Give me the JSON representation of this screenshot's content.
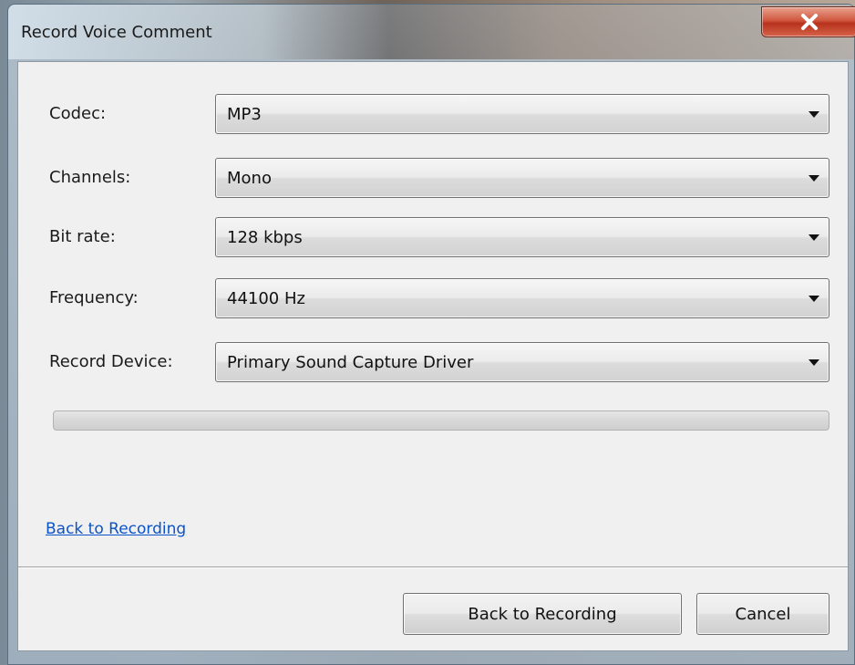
{
  "window": {
    "title": "Record Voice Comment",
    "close_icon": "close-icon"
  },
  "fields": [
    {
      "label": "Codec:",
      "value": "MP3"
    },
    {
      "label": "Channels:",
      "value": "Mono"
    },
    {
      "label": "Bit rate:",
      "value": "128 kbps"
    },
    {
      "label": "Frequency:",
      "value": "44100 Hz"
    },
    {
      "label": "Record Device:",
      "value": "Primary Sound Capture Driver"
    }
  ],
  "progress": {
    "percent": 0
  },
  "link": {
    "label": "Back to Recording"
  },
  "buttons": {
    "primary_label": "Back to Recording",
    "cancel_label": "Cancel"
  },
  "colors": {
    "close_button": "#c8412a",
    "link": "#0b53c8",
    "progress_fill": "#06b025"
  }
}
